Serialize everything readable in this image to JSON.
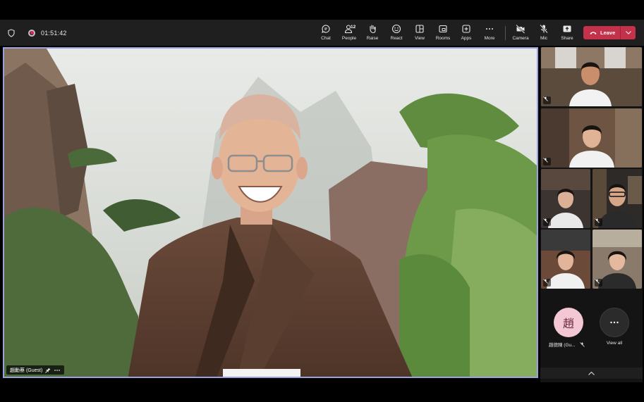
{
  "meeting": {
    "timer": "01:51:42"
  },
  "toolbar": {
    "items": [
      {
        "id": "chat",
        "label": "Chat",
        "icon": "chat-icon"
      },
      {
        "id": "people",
        "label": "People",
        "icon": "people-icon",
        "count": "12"
      },
      {
        "id": "raise",
        "label": "Raise",
        "icon": "hand-icon"
      },
      {
        "id": "react",
        "label": "React",
        "icon": "smile-icon"
      },
      {
        "id": "view",
        "label": "View",
        "icon": "view-icon"
      },
      {
        "id": "rooms",
        "label": "Rooms",
        "icon": "rooms-icon"
      },
      {
        "id": "apps",
        "label": "Apps",
        "icon": "apps-icon"
      },
      {
        "id": "more",
        "label": "More",
        "icon": "more-icon"
      },
      {
        "id": "camera",
        "label": "Camera",
        "icon": "camera-off-icon"
      },
      {
        "id": "mic",
        "label": "Mic",
        "icon": "mic-off-icon"
      },
      {
        "id": "share",
        "label": "Share",
        "icon": "share-icon"
      }
    ],
    "leave_label": "Leave"
  },
  "stage": {
    "speaker_name": "趙勳蔡 (Guest)"
  },
  "gallery": {
    "guest_initial": "趙",
    "guest_name": "趙德陳 (Gu...",
    "view_all_label": "View all"
  },
  "colors": {
    "leave": "#c4314b",
    "accent_border": "#9aa0e0",
    "toolbar_bg": "#1f1f1f"
  }
}
